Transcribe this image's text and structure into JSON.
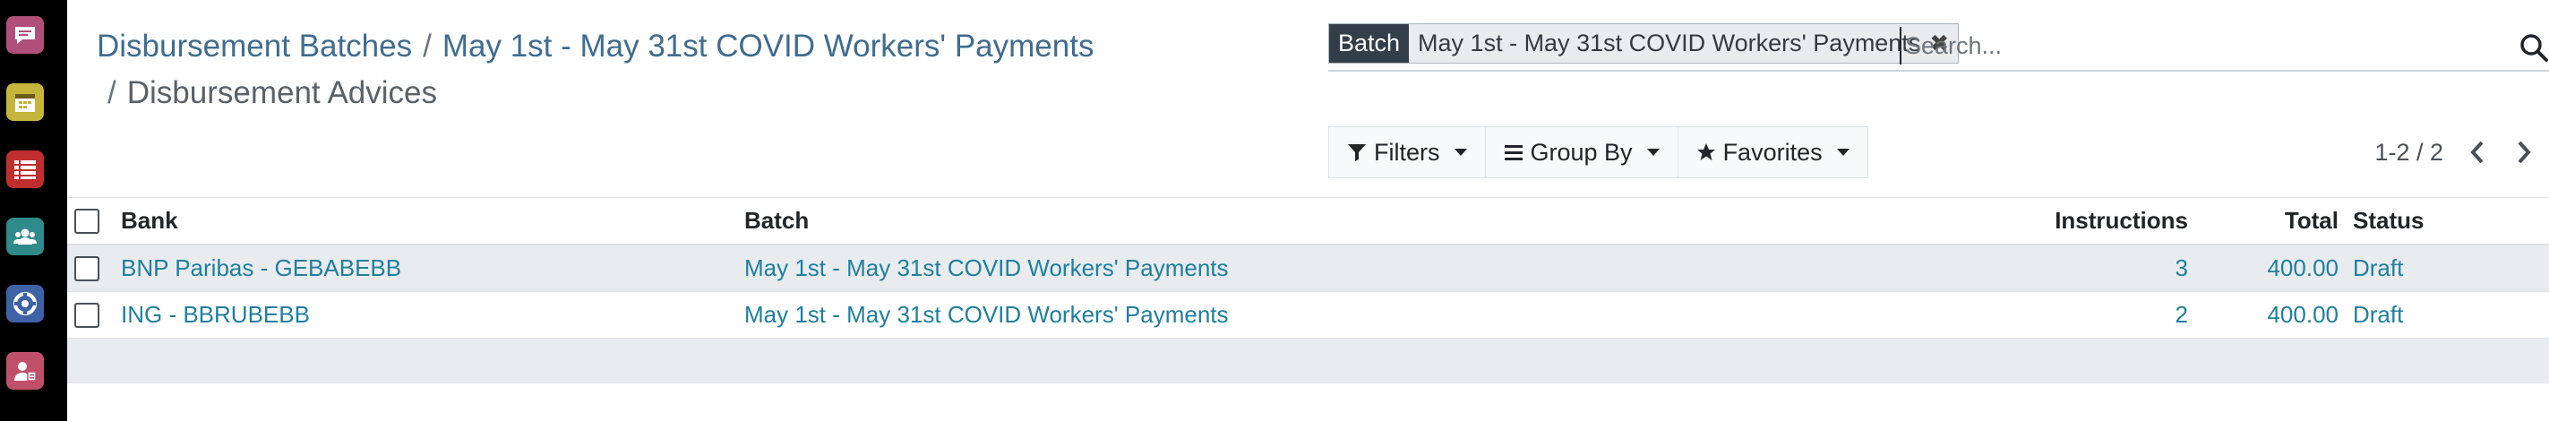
{
  "sidebar": {
    "apps": [
      {
        "icon": "discuss-icon",
        "color": "#b0507a"
      },
      {
        "icon": "calendar-icon",
        "color": "#c6b53c"
      },
      {
        "icon": "list-icon",
        "color": "#c02f2f"
      },
      {
        "icon": "contacts-icon",
        "color": "#2f8a8a"
      },
      {
        "icon": "helpdesk-icon",
        "color": "#3d62a6"
      },
      {
        "icon": "employees-icon",
        "color": "#c0506a"
      }
    ]
  },
  "breadcrumb": {
    "items": [
      "Disbursement Batches",
      "May 1st - May 31st COVID Workers' Payments"
    ],
    "separator": "/",
    "current": "Disbursement Advices"
  },
  "search": {
    "facet_label": "Batch",
    "facet_value": "May 1st - May 31st COVID Workers' Payments",
    "facet_remove": "✖",
    "placeholder": "Search..."
  },
  "toolbar": {
    "filters": "Filters",
    "group_by": "Group By",
    "favorites": "Favorites"
  },
  "pager": {
    "value": "1-2 / 2"
  },
  "table": {
    "columns": {
      "bank": "Bank",
      "batch": "Batch",
      "instructions": "Instructions",
      "total": "Total",
      "status": "Status"
    },
    "rows": [
      {
        "bank": "BNP Paribas - GEBABEBB",
        "batch": "May 1st - May 31st COVID Workers' Payments",
        "instructions": "3",
        "total": "400.00",
        "status": "Draft"
      },
      {
        "bank": "ING - BBRUBEBB",
        "batch": "May 1st - May 31st COVID Workers' Payments",
        "instructions": "2",
        "total": "400.00",
        "status": "Draft"
      }
    ]
  },
  "colors": {
    "link": "#1f7f9e",
    "breadcrumb_link": "#3f6c8f",
    "facet_label_bg": "#333e48"
  }
}
